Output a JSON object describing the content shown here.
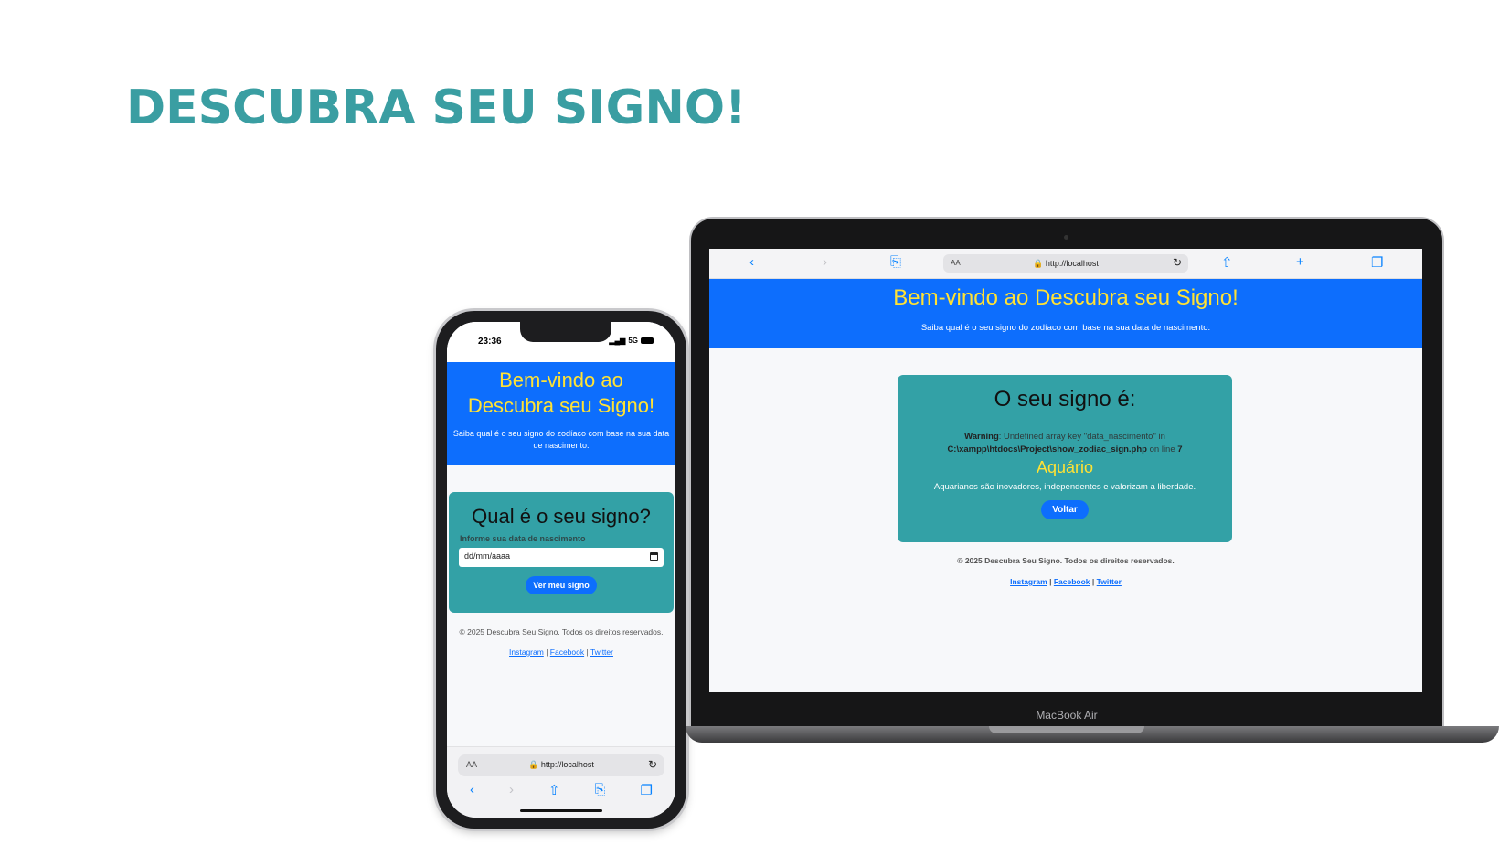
{
  "slide": {
    "title": "DESCUBRA SEU SIGNO!"
  },
  "phone": {
    "status": {
      "time": "23:36",
      "network": "5G"
    },
    "header": {
      "title": "Bem-vindo ao Descubra seu Signo!",
      "subtitle": "Saiba qual é o seu signo do zodíaco com base na sua data de nascimento."
    },
    "form": {
      "heading": "Qual é o seu signo?",
      "field_label": "Informe sua data de nascimento",
      "date_placeholder": "dd/mm/aaaa",
      "submit_label": "Ver meu signo"
    },
    "footer": {
      "copyright": "© 2025 Descubra Seu Signo. Todos os direitos reservados.",
      "links": [
        "Instagram",
        "Facebook",
        "Twitter"
      ],
      "separator": "|"
    },
    "browser": {
      "aa": "AA",
      "url": "http://localhost"
    }
  },
  "laptop": {
    "model": "MacBook Air",
    "browser": {
      "aa": "AA",
      "url": "http://localhost"
    },
    "header": {
      "title": "Bem-vindo ao Descubra seu Signo!",
      "subtitle": "Saiba qual é o seu signo do zodíaco com base na sua data de nascimento."
    },
    "result": {
      "heading": "O seu signo é:",
      "warning_label": "Warning",
      "warning_text": ": Undefined array key \"data_nascimento\" in",
      "warning_path": "C:\\xampp\\htdocs\\Project\\show_zodiac_sign.php",
      "warning_line_text": " on line ",
      "warning_line": "7",
      "sign": "Aquário",
      "description": "Aquarianos são inovadores, independentes e valorizam a liberdade.",
      "back_label": "Voltar"
    },
    "footer": {
      "copyright": "© 2025 Descubra Seu Signo. Todos os direitos reservados.",
      "links": [
        "Instagram",
        "Facebook",
        "Twitter"
      ],
      "separator": "|"
    }
  }
}
